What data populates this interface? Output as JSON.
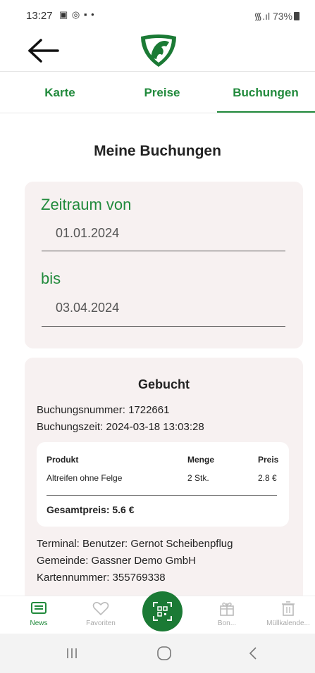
{
  "status_bar": {
    "time": "13:27",
    "left_icons": "▣ ◎ ▪ •",
    "right_text": "᯾.ıl 73%",
    "icons": [
      "gallery-icon",
      "whatsapp-icon",
      "teams-icon",
      "wifi-icon",
      "signal-icon",
      "battery-icon"
    ]
  },
  "header": {
    "back_icon": "arrow-left-icon",
    "logo": "green-horse-shield-logo"
  },
  "tabs": [
    {
      "label": "Karte"
    },
    {
      "label": "Preise"
    },
    {
      "label": "Buchungen",
      "active": true
    }
  ],
  "page_title": "Meine Buchungen",
  "date_filter": {
    "from_label": "Zeitraum von",
    "from_value": "01.01.2024",
    "to_label": "bis",
    "to_value": "03.04.2024"
  },
  "booking": {
    "status_title": "Gebucht",
    "number_line": "Buchungsnummer: 1722661",
    "time_line": "Buchungszeit: 2024-03-18 13:03:28",
    "table": {
      "headers": {
        "product": "Produkt",
        "quantity": "Menge",
        "price": "Preis"
      },
      "rows": [
        {
          "product": "Altreifen ohne Felge",
          "quantity": "2 Stk.",
          "price": "2.8 €"
        }
      ],
      "total": "Gesamtpreis: 5.6 €"
    },
    "terminal_line": "Terminal: Benutzer: Gernot Scheibenpflug",
    "municipality_line": "Gemeinde: Gassner Demo GmbH",
    "card_line": "Kartennummer: 355769338"
  },
  "bottom_nav": {
    "items": [
      {
        "label": "News",
        "icon": "news-icon",
        "active": true
      },
      {
        "label": "Favoriten",
        "icon": "heart-icon"
      },
      {
        "label": "Bon...",
        "icon": "gift-icon"
      },
      {
        "label": "Müllkalende...",
        "icon": "trash-icon"
      }
    ],
    "center_icon": "qr-scan-icon"
  },
  "colors": {
    "accent": "#218a3c",
    "card_background": "#f7f1f1",
    "scan_button": "#1b7a35"
  }
}
